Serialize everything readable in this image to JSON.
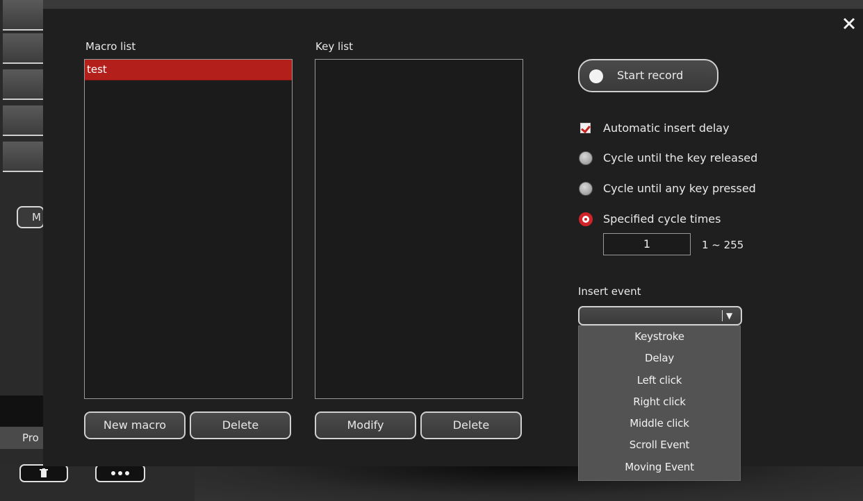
{
  "background": {
    "side_button_partial": "M",
    "profile_partial": "Pro",
    "bottom_buttons": [
      "trash-icon",
      "more-dots-icon"
    ]
  },
  "dialog": {
    "macro_list": {
      "label": "Macro list",
      "items": [
        "test"
      ],
      "selected": "test",
      "buttons": {
        "new": "New macro",
        "delete": "Delete"
      }
    },
    "key_list": {
      "label": "Key list",
      "items": [],
      "buttons": {
        "modify": "Modify",
        "delete": "Delete"
      }
    },
    "record": {
      "label": "Start record"
    },
    "options": {
      "auto_delay": {
        "label": "Automatic insert delay",
        "checked": true
      },
      "cycle_released": {
        "label": "Cycle until the key released",
        "selected": false
      },
      "cycle_any": {
        "label": "Cycle until any key pressed",
        "selected": false
      },
      "cycle_times": {
        "label": "Specified cycle times",
        "selected": true
      }
    },
    "cycle": {
      "value": "1",
      "range": "1 ~ 255"
    },
    "insert_event": {
      "label": "Insert event",
      "value": "",
      "options": [
        "Keystroke",
        "Delay",
        "Left click",
        "Right click",
        "Middle click",
        "Scroll Event",
        "Moving Event"
      ]
    },
    "colors": {
      "accent_red": "#b3201c",
      "radio_red": "#d0242b"
    }
  }
}
